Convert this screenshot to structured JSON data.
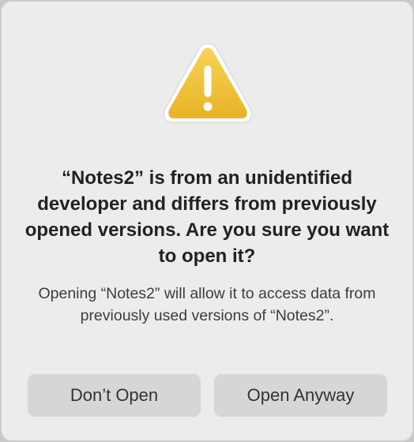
{
  "dialog": {
    "icon": "warning-triangle-icon",
    "title": "“Notes2” is from an unidentified developer and differs from previously opened versions. Are you sure you want to open it?",
    "message": "Opening “Notes2” will allow it to access data from previously used versions of “Notes2”.",
    "buttons": {
      "dont_open": "Don’t Open",
      "open_anyway": "Open Anyway"
    }
  },
  "colors": {
    "warning_yellow": "#f0c33a",
    "dialog_background": "#ececec",
    "button_background": "#d6d6d6"
  }
}
